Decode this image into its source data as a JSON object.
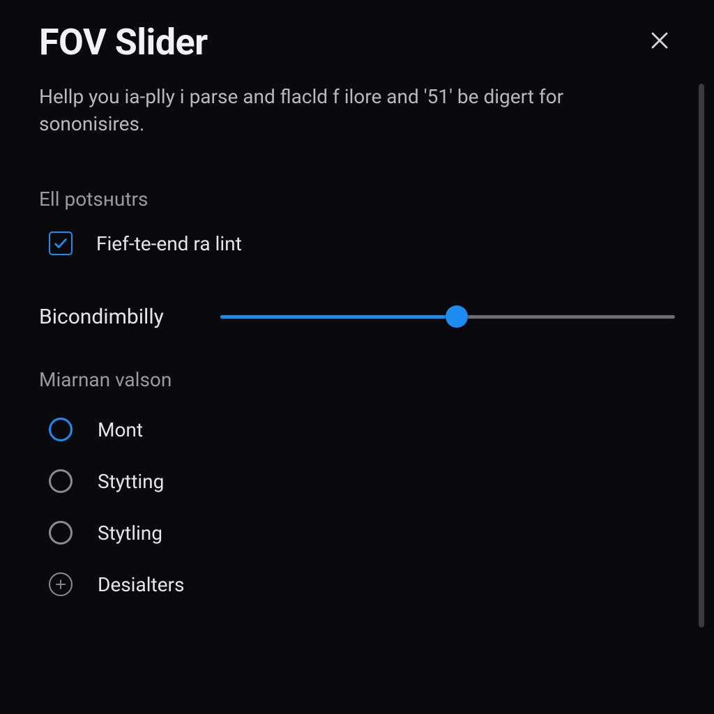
{
  "title": "FOV Slider",
  "description": "Hellp you ia-plly i parse and flacld f ilore and '51' be digert for sononisires.",
  "section_posts_label": "Ell potsнutrs",
  "checkbox": {
    "label": "Fief-te-end ra lint",
    "checked": true
  },
  "slider": {
    "label": "Bicondimbilly",
    "percent": 52
  },
  "section_options_label": "Miarnan valson",
  "options": [
    {
      "label": "Mont",
      "type": "radio",
      "active": true
    },
    {
      "label": "Stytting",
      "type": "radio",
      "active": false
    },
    {
      "label": "Stytling",
      "type": "radio",
      "active": false
    },
    {
      "label": "Desialters",
      "type": "add",
      "active": false
    }
  ],
  "colors": {
    "accent": "#1d8cf0",
    "bg": "#0a0a0c"
  }
}
